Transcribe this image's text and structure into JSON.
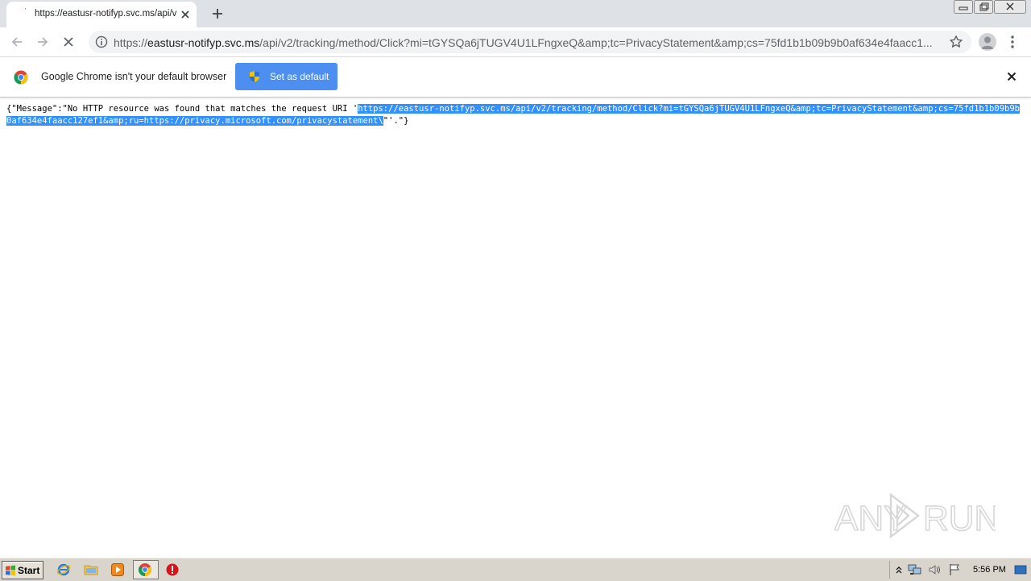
{
  "tab": {
    "title": "https://eastusr-notifyp.svc.ms/api/v"
  },
  "omnibox": {
    "url_scheme": "https://",
    "url_host": "eastusr-notifyp.svc.ms",
    "url_path": "/api/v2/tracking/method/Click?mi=tGYSQa6jTUGV4U1LFngxeQ&amp;tc=PrivacyStatement&amp;cs=75fd1b1b09b9b0af634e4faacc1..."
  },
  "infobar": {
    "message": "Google Chrome isn't your default browser",
    "button_label": "Set as default"
  },
  "page": {
    "text_before": "{\"Message\":\"No HTTP resource was found that matches the request URI '",
    "selected_text": "https://eastusr-notifyp.svc.ms/api/v2/tracking/method/Click?mi=tGYSQa6jTUGV4U1LFngxeQ&amp;tc=PrivacyStatement&amp;cs=75fd1b1b09b9b0af634e4faacc127ef1&amp;ru=https://privacy.microsoft.com/privacystatement\\",
    "text_after": "\"'.\"}"
  },
  "watermark": {
    "text_left": "ANY",
    "text_right": "RUN"
  },
  "taskbar": {
    "start_label": "Start",
    "clock": "5:56 PM",
    "icons": [
      "ie-icon",
      "folder-icon",
      "media-player-icon",
      "chrome-icon",
      "stop-icon"
    ]
  },
  "colors": {
    "tabstrip_bg": "#dee1e6",
    "selection_bg": "#3390ff",
    "button_blue": "#4d8ff1",
    "taskbar_bg": "#d9d5cc"
  }
}
